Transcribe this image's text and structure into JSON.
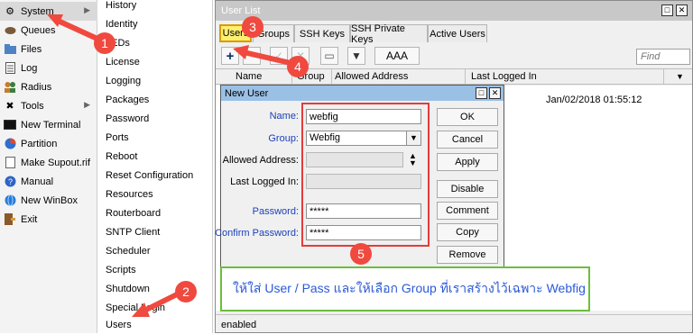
{
  "left_menu": {
    "items": [
      {
        "label": "System",
        "icon": "gear-icon",
        "has_submenu": true,
        "selected": true
      },
      {
        "label": "Queues",
        "icon": "queue-icon",
        "has_submenu": false
      },
      {
        "label": "Files",
        "icon": "folder-icon",
        "has_submenu": false
      },
      {
        "label": "Log",
        "icon": "log-icon",
        "has_submenu": false
      },
      {
        "label": "Radius",
        "icon": "users-icon",
        "has_submenu": false
      },
      {
        "label": "Tools",
        "icon": "wrench-icon",
        "has_submenu": true
      },
      {
        "label": "New Terminal",
        "icon": "terminal-icon",
        "has_submenu": false
      },
      {
        "label": "Partition",
        "icon": "piechart-icon",
        "has_submenu": false
      },
      {
        "label": "Make Supout.rif",
        "icon": "document-icon",
        "has_submenu": false
      },
      {
        "label": "Manual",
        "icon": "help-icon",
        "has_submenu": false
      },
      {
        "label": "New WinBox",
        "icon": "globe-icon",
        "has_submenu": false
      },
      {
        "label": "Exit",
        "icon": "exit-icon",
        "has_submenu": false
      }
    ]
  },
  "sub_menu": {
    "items": [
      {
        "label": "History"
      },
      {
        "label": "Identity"
      },
      {
        "label": "LEDs"
      },
      {
        "label": "License"
      },
      {
        "label": "Logging"
      },
      {
        "label": "Packages"
      },
      {
        "label": "Password"
      },
      {
        "label": "Ports"
      },
      {
        "label": "Reboot"
      },
      {
        "label": "Reset Configuration"
      },
      {
        "label": "Resources"
      },
      {
        "label": "Routerboard"
      },
      {
        "label": "SNTP Client"
      },
      {
        "label": "Scheduler"
      },
      {
        "label": "Scripts"
      },
      {
        "label": "Shutdown"
      },
      {
        "label": "Special Login"
      },
      {
        "label": "Users"
      }
    ]
  },
  "user_list": {
    "title": "User List",
    "tabs": [
      {
        "label": "Users",
        "active": true
      },
      {
        "label": "Groups",
        "active": false
      },
      {
        "label": "SSH Keys",
        "active": false
      },
      {
        "label": "SSH Private Keys",
        "active": false
      },
      {
        "label": "Active Users",
        "active": false
      }
    ],
    "toolbar": {
      "add": "+",
      "remove": "−",
      "enable": "✓",
      "disable": "✕",
      "comment": "▭",
      "filter": "▼",
      "aaa_label": "AAA",
      "find_placeholder": "Find"
    },
    "columns": [
      "Name",
      "Group",
      "Allowed Address",
      "Last Logged In"
    ],
    "rows": [
      {
        "last_logged_in": "Jan/02/2018 01:55:12"
      }
    ],
    "status": "enabled"
  },
  "new_user": {
    "title": "New User",
    "fields": {
      "name": {
        "label": "Name:",
        "value": "webfig"
      },
      "group": {
        "label": "Group:",
        "value": "Webfig"
      },
      "allowed_address": {
        "label": "Allowed Address:",
        "value": ""
      },
      "last_logged_in": {
        "label": "Last Logged In:",
        "value": ""
      },
      "password": {
        "label": "Password:",
        "value": "*****"
      },
      "confirm_password": {
        "label": "Confirm Password:",
        "value": "*****"
      }
    },
    "buttons": [
      "OK",
      "Cancel",
      "Apply",
      "Disable",
      "Comment",
      "Copy",
      "Remove"
    ]
  },
  "annotations": {
    "badges": [
      "1",
      "2",
      "3",
      "4",
      "5"
    ],
    "callout_text": "ให้ใส่ User / Pass และให้เลือก Group ที่เราสร้างไว้เฉพาะ Webfig"
  },
  "colors": {
    "annotation_red": "#e53b3b",
    "callout_green": "#6bbf3a",
    "callout_text": "#2b59d9",
    "active_tab": "#ffef70",
    "dialog_titlebar": "#9ac0e5"
  }
}
